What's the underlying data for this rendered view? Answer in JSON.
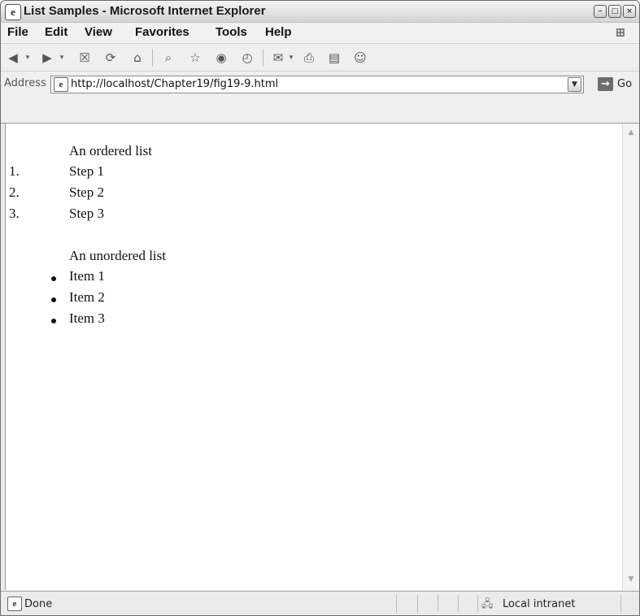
{
  "window": {
    "title": "List Samples - Microsoft Internet Explorer",
    "app_icon": "ie-icon",
    "controls": {
      "minimize": "minimize-icon",
      "maximize": "maximize-icon",
      "close": "close-icon"
    }
  },
  "menu": {
    "items": [
      "File",
      "Edit",
      "View",
      "Favorites",
      "Tools",
      "Help"
    ],
    "logo": "windows-logo-icon"
  },
  "toolbar": {
    "buttons": [
      "back-icon",
      "forward-icon",
      "stop-icon",
      "refresh-icon",
      "home-icon",
      "search-icon",
      "favorites-icon",
      "media-icon",
      "history-icon",
      "mail-icon",
      "print-icon",
      "edit-icon",
      "messenger-icon"
    ]
  },
  "address": {
    "label": "Address",
    "url": "http://localhost/Chapter19/fig19-9.html",
    "go_label": "Go"
  },
  "content": {
    "ordered_caption": "An ordered list",
    "ordered_items": [
      {
        "num": "1.",
        "text": "Step 1"
      },
      {
        "num": "2.",
        "text": "Step 2"
      },
      {
        "num": "3.",
        "text": "Step 3"
      }
    ],
    "unordered_caption": "An unordered list",
    "unordered_items": [
      "Item 1",
      "Item 2",
      "Item 3"
    ]
  },
  "status": {
    "text": "Done",
    "zone": "Local intranet"
  }
}
